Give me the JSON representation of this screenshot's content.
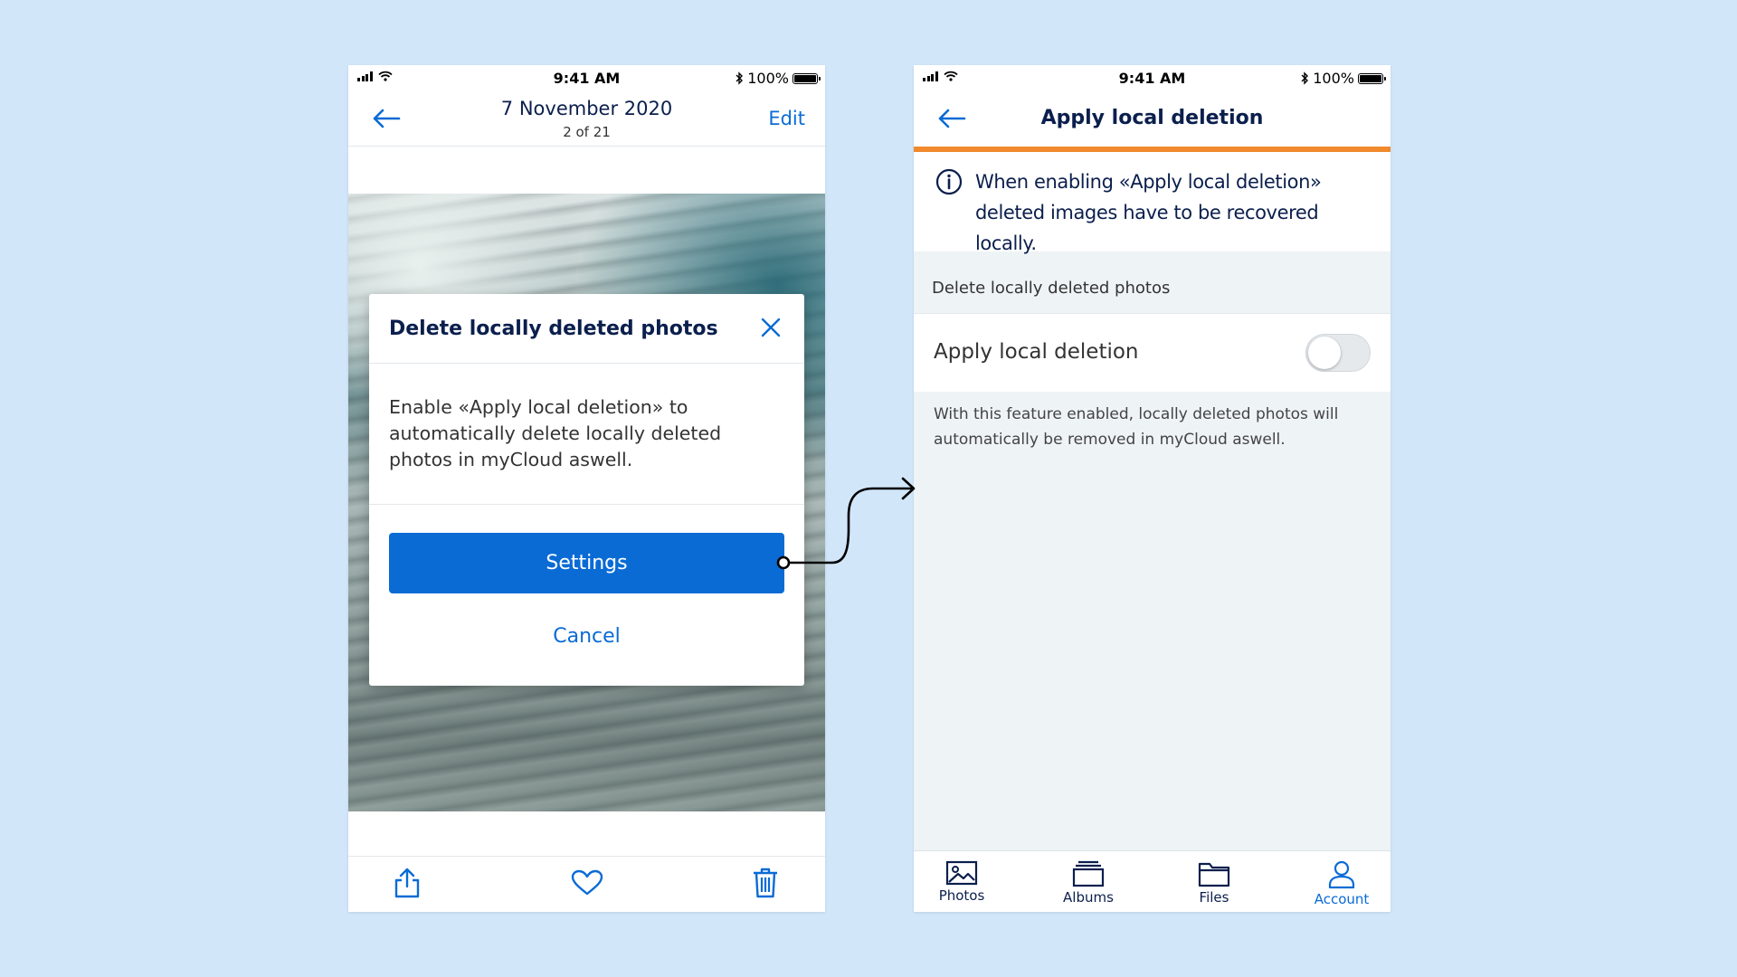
{
  "status": {
    "time": "9:41 AM",
    "battery": "100%"
  },
  "left": {
    "header": {
      "title": "7 November 2020",
      "subtitle": "2 of 21",
      "edit_label": "Edit"
    },
    "modal": {
      "title": "Delete locally deleted photos",
      "body": "Enable «Apply local deletion» to automatically delete locally deleted photos in myCloud aswell.",
      "settings_label": "Settings",
      "cancel_label": "Cancel"
    },
    "toolbar": {
      "icons": [
        "share-icon",
        "heart-icon",
        "trash-icon"
      ]
    }
  },
  "right": {
    "header": {
      "title": "Apply local deletion"
    },
    "info": "When enabling «Apply local deletion» deleted images have to be recovered locally.",
    "section_header": "Delete locally deleted photos",
    "toggle_row": {
      "label": "Apply local deletion",
      "enabled": false
    },
    "footer_text": "With this feature  enabled, locally deleted photos will automatically be removed in myCloud aswell.",
    "tabs": [
      {
        "label": "Photos",
        "icon": "photos-icon",
        "active": false
      },
      {
        "label": "Albums",
        "icon": "albums-icon",
        "active": false
      },
      {
        "label": "Files",
        "icon": "files-icon",
        "active": false
      },
      {
        "label": "Account",
        "icon": "account-icon",
        "active": true
      }
    ]
  },
  "colors": {
    "accent": "#0a6bd5",
    "navy": "#0b1f4d",
    "orange": "#f08a2c",
    "background": "#d2e6fa"
  }
}
